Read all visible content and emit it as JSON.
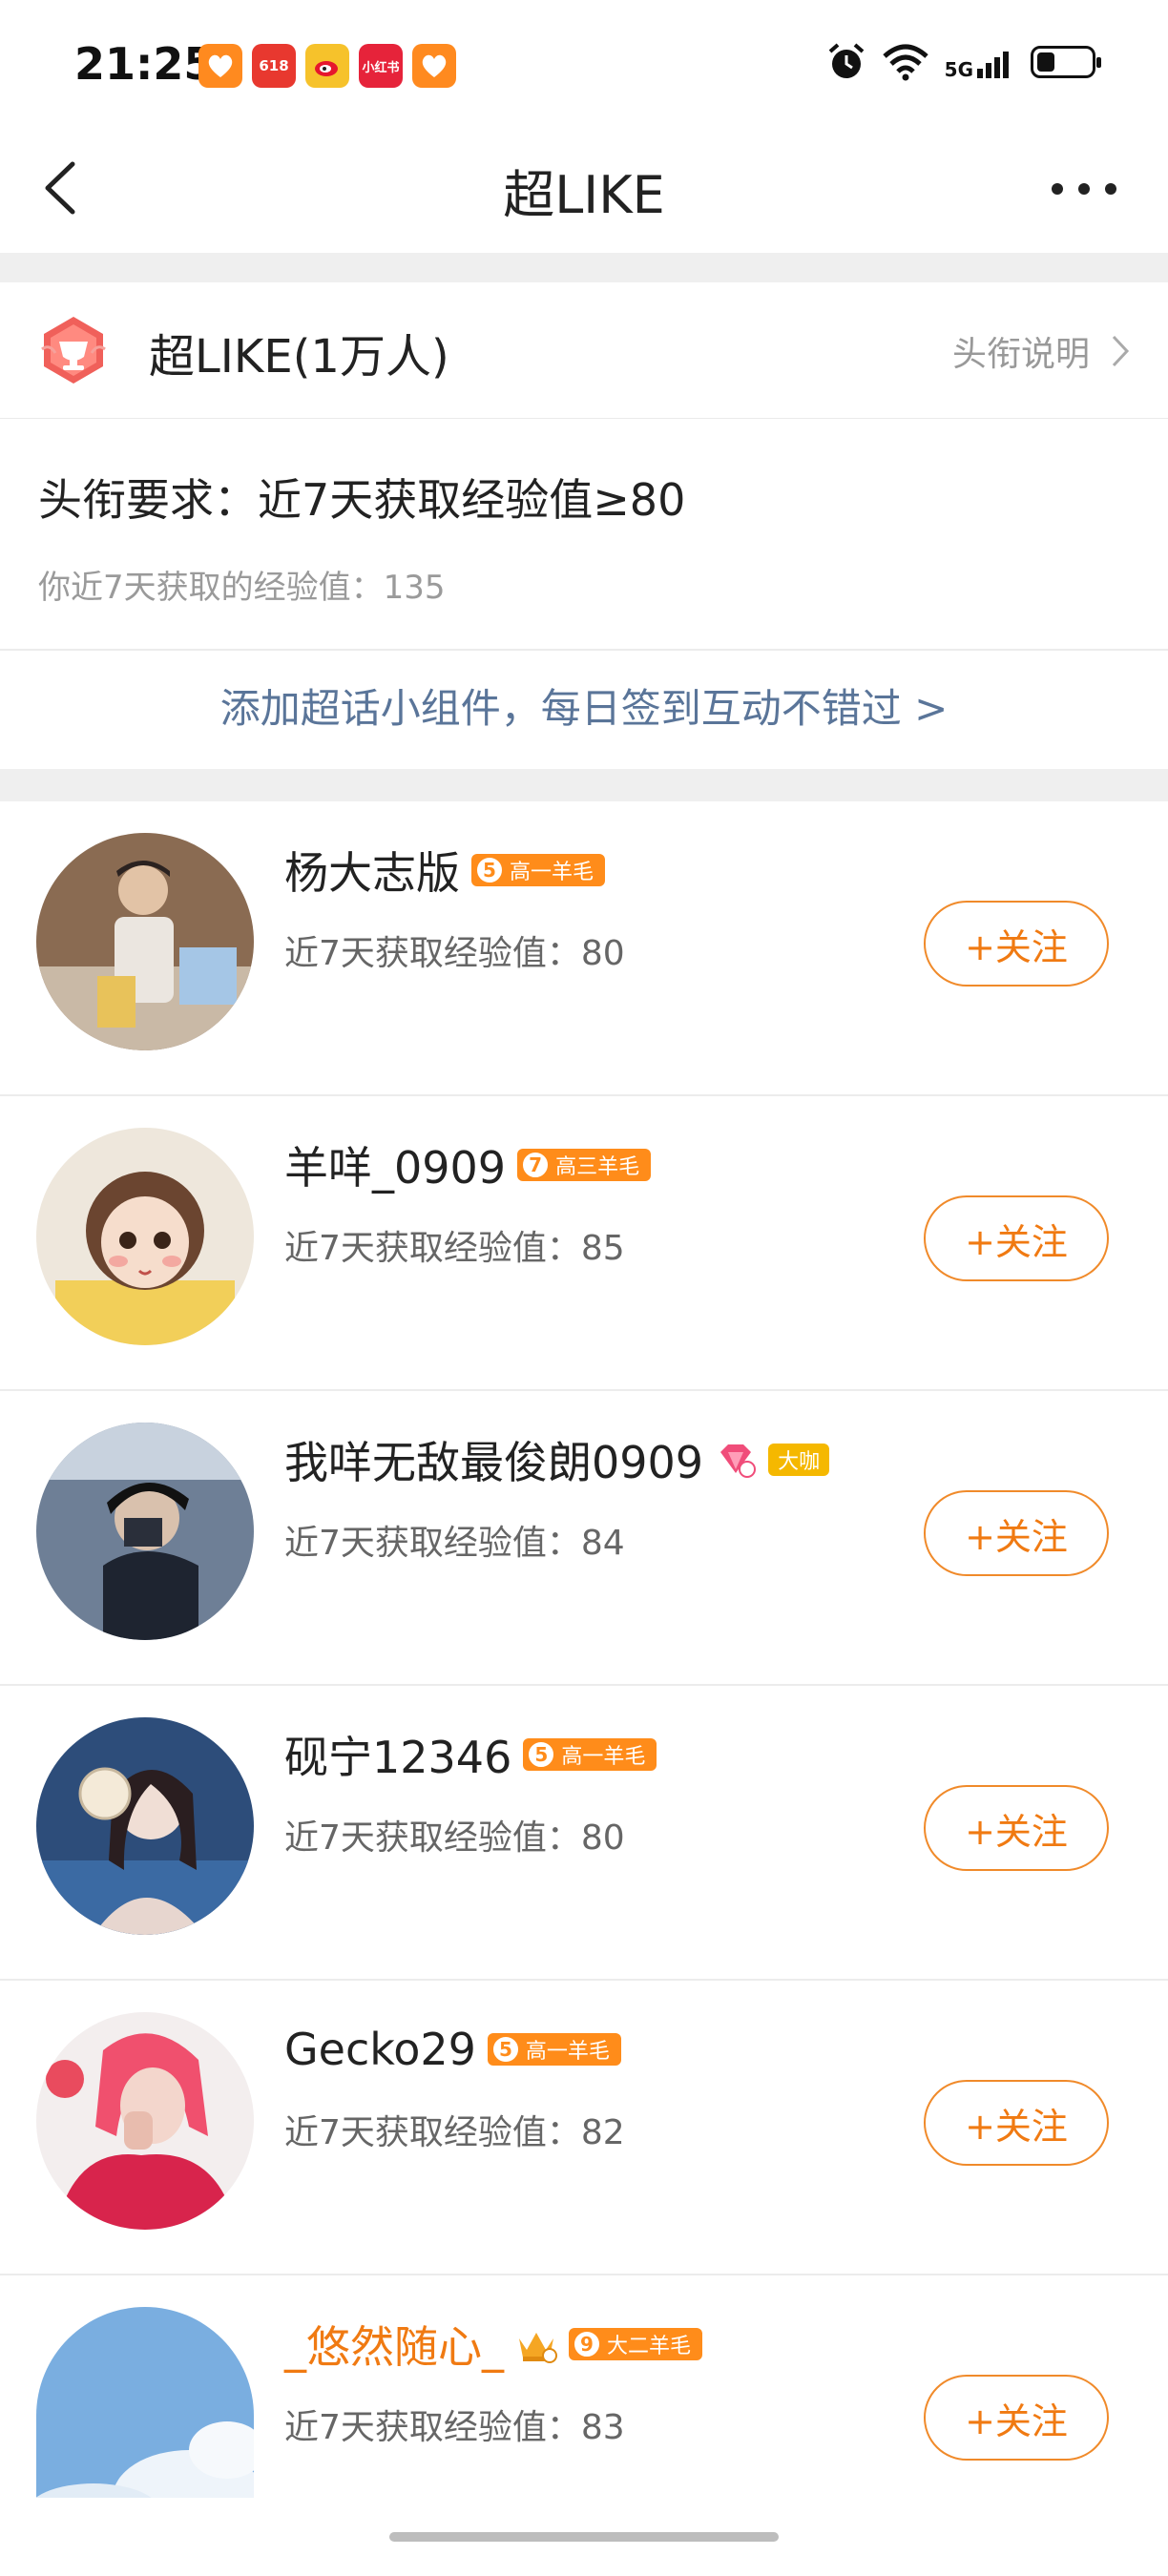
{
  "status_bar": {
    "time": "21:25",
    "app_icons": [
      {
        "name": "heart-app-icon",
        "color": "#ff8a1f",
        "label": ""
      },
      {
        "name": "618-app-icon",
        "color": "#e8382f",
        "label": "618"
      },
      {
        "name": "weibo-app-icon",
        "color": "#f6c22b",
        "label": ""
      },
      {
        "name": "xiaohongshu-app-icon",
        "color": "#e6233a",
        "label": "小红书"
      },
      {
        "name": "heart-app-icon-2",
        "color": "#ff8a1f",
        "label": ""
      }
    ],
    "network": "5G"
  },
  "nav": {
    "title": "超LIKE"
  },
  "title_row": {
    "title": "超LIKE(1万人)",
    "explain": "头衔说明"
  },
  "requirement": {
    "text": "头衔要求：近7天获取经验值≥80",
    "mine": "你近7天获取的经验值：135"
  },
  "widget_link": "添加超话小组件，每日签到互动不错过 >",
  "users": [
    {
      "name": "杨大志版",
      "name_color": "normal",
      "badges": [
        {
          "type": "level",
          "level": "5",
          "label": "高一羊毛"
        }
      ],
      "exp": "近7天获取经验值：80",
      "follow": "+关注",
      "avatar": "avatar-1"
    },
    {
      "name": "羊咩_0909",
      "name_color": "normal",
      "badges": [
        {
          "type": "level",
          "level": "7",
          "label": "高三羊毛"
        }
      ],
      "exp": "近7天获取经验值：85",
      "follow": "+关注",
      "avatar": "avatar-2"
    },
    {
      "name": "我咩无敌最俊朗0909",
      "name_color": "normal",
      "badges": [
        {
          "type": "gem"
        },
        {
          "type": "tag",
          "label": "大咖"
        }
      ],
      "exp": "近7天获取经验值：84",
      "follow": "+关注",
      "avatar": "avatar-3"
    },
    {
      "name": "砚宁12346",
      "name_color": "normal",
      "badges": [
        {
          "type": "level",
          "level": "5",
          "label": "高一羊毛"
        }
      ],
      "exp": "近7天获取经验值：80",
      "follow": "+关注",
      "avatar": "avatar-4"
    },
    {
      "name": "Gecko29",
      "name_color": "normal",
      "badges": [
        {
          "type": "level",
          "level": "5",
          "label": "高一羊毛"
        }
      ],
      "exp": "近7天获取经验值：82",
      "follow": "+关注",
      "avatar": "avatar-5"
    },
    {
      "name": "_悠然随心_",
      "name_color": "orange",
      "badges": [
        {
          "type": "crown"
        },
        {
          "type": "level",
          "level": "9",
          "label": "大二羊毛"
        }
      ],
      "exp": "近7天获取经验值：83",
      "follow": "+关注",
      "avatar": "avatar-6"
    }
  ],
  "colors": {
    "accent": "#f07a12",
    "link": "#5a7599",
    "divider": "#efefef"
  }
}
